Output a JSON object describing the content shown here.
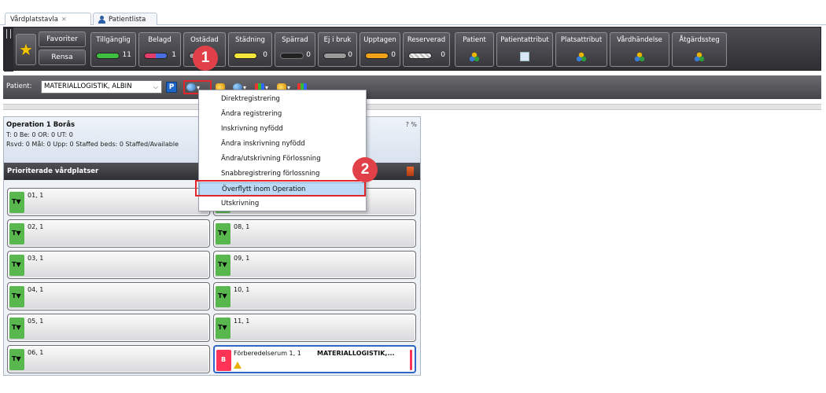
{
  "tabs": [
    {
      "label": "Vårdplatstavla",
      "close": "✕"
    },
    {
      "label": "Patientlista"
    }
  ],
  "toolbar": {
    "favorites_label": "Favoriter",
    "clear_label": "Rensa",
    "status_buttons": [
      {
        "label": "Tillgänglig",
        "count": "11",
        "color": "#3fbf3f"
      },
      {
        "label": "Belagd",
        "count": "1",
        "color": "#e23c6a"
      },
      {
        "label": "Ostädad",
        "count": "",
        "color": "#9a9a9a"
      },
      {
        "label": "Städning",
        "count": "0",
        "color": "#f2e43a"
      },
      {
        "label": "Spärrad",
        "count": "0",
        "color": "#222222"
      },
      {
        "label": "Ej i bruk",
        "count": "0",
        "color": "#9a9a9a"
      },
      {
        "label": "Upptagen",
        "count": "0",
        "color": "#f2a218"
      },
      {
        "label": "Reserverad",
        "count": "0",
        "color": "#d6d6d6"
      }
    ],
    "attr_buttons": [
      {
        "label": "Patient",
        "icon": "cubes-icon"
      },
      {
        "label": "Patientattribut",
        "icon": "grid-icon"
      },
      {
        "label": "Platsattribut",
        "icon": "cubes-icon"
      },
      {
        "label": "Vårdhändelse",
        "icon": "cubes-icon"
      },
      {
        "label": "Åtgärdssteg",
        "icon": "cubes-icon"
      }
    ]
  },
  "patient_bar": {
    "label": "Patient:",
    "selected": "MATERIALLOGISTIK, ALBIN",
    "p_button": "P"
  },
  "callouts": [
    "1",
    "2"
  ],
  "menu": {
    "items": [
      "Direktregistrering",
      "Ändra registrering",
      "Inskrivning nyfödd",
      "Ändra inskrivning nyfödd",
      "Ändra/utskrivning Förlossning",
      "Snabbregistrering förlossning",
      "Överflytt inom Operation",
      "Utskrivning"
    ],
    "selected_index": 6
  },
  "panel": {
    "title": "Operation 1 Borås",
    "percent": "? %",
    "stats_line1": "T: 0 Be: 0 OR: 0 UT: 0",
    "stats_line2": "Rsvd: 0 Mål: 0 Upp: 0 Staffed beds: 0 Staffed/Available",
    "priority_label": "Prioriterade vårdplatser"
  },
  "beds": {
    "left": [
      "01, 1",
      "02, 1",
      "03, 1",
      "04, 1",
      "05, 1",
      "06, 1"
    ],
    "right": [
      "",
      "08, 1",
      "09, 1",
      "10, 1",
      "11, 1"
    ],
    "status_glyph": "T▼",
    "occupied": {
      "badge": "B",
      "name": "Förberedelserum 1, 1",
      "patient": "MATERIALLOGISTIK,..."
    }
  }
}
